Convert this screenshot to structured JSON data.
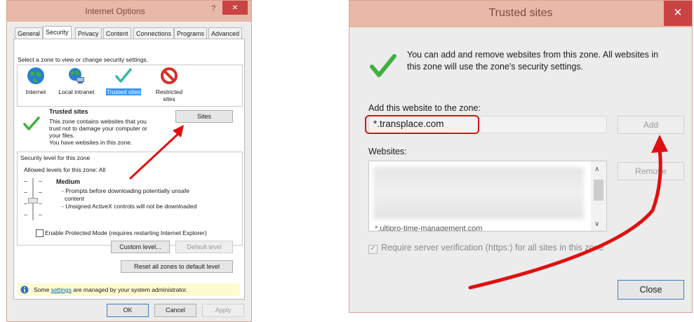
{
  "left_dialog": {
    "title": "Internet Options",
    "help_label": "?",
    "close_label": "×",
    "tabs": [
      "General",
      "Security",
      "Privacy",
      "Content",
      "Connections",
      "Programs",
      "Advanced"
    ],
    "zone_prompt": "Select a zone to view or change security settings.",
    "zones": [
      {
        "label": "Internet",
        "icon": "globe-icon"
      },
      {
        "label": "Local intranet",
        "icon": "intranet-icon"
      },
      {
        "label": "Trusted sites",
        "icon": "checkmark-icon"
      },
      {
        "label": "Restricted sites",
        "icon": "no-entry-icon"
      }
    ],
    "zone_title": "Trusted sites",
    "zone_desc_lines": [
      "This zone contains websites that you",
      "trust not to damage your computer or",
      "your files.",
      "You have websites in this zone."
    ],
    "sites_button": "Sites",
    "security_group_label": "Security level for this zone",
    "allowed_levels": "Allowed levels for this zone: All",
    "level_name": "Medium",
    "level_bullets": [
      "- Prompts before downloading potentially unsafe",
      "content",
      "- Unsigned ActiveX controls will not be downloaded"
    ],
    "protected_mode_label": "Enable Protected Mode (requires restarting Internet Explorer)",
    "custom_level_button": "Custom level...",
    "default_level_button": "Default level",
    "reset_all_button": "Reset all zones to default level",
    "info_prefix": "Some ",
    "info_link": "settings",
    "info_suffix": " are managed by your system administrator.",
    "ok_button": "OK",
    "cancel_button": "Cancel",
    "apply_button": "Apply"
  },
  "right_dialog": {
    "title": "Trusted sites",
    "close_label": "×",
    "description_line1": "You can add and remove websites from this zone. All websites in",
    "description_line2": "this zone will use the zone's security settings.",
    "add_label": "Add this website to the zone:",
    "add_input_value": "*.transplace.com",
    "add_button": "Add",
    "websites_label": "Websites:",
    "websites_partial_text": "*.ultipro-time-management.com",
    "remove_button": "Remove",
    "require_verification_label": "Require server verification (https:) for all sites in this zone",
    "close_button": "Close"
  },
  "colors": {
    "title_bar": "#e8b8a8",
    "close_red": "#c94343",
    "annotation_red": "#e01010",
    "highlight_blue": "#3399ff",
    "info_yellow": "#fffbd0"
  }
}
